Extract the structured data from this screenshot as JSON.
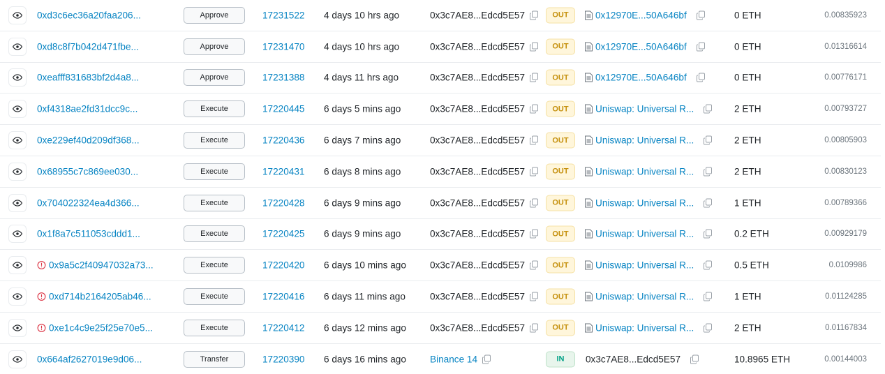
{
  "icons": {
    "view": "eye-icon",
    "error": "alert-circle-icon",
    "copy": "copy-icon",
    "contract": "document-icon"
  },
  "colors": {
    "link": "#0784c3",
    "out_bg": "#fff6db",
    "out_text": "#c5900c",
    "in_bg": "#e8f5ec",
    "in_text": "#00a186",
    "error": "#dc3545"
  },
  "rows": [
    {
      "hash": "0xd3c6ec36a20faa206...",
      "error": false,
      "method": "Approve",
      "block": "17231522",
      "age": "4 days 10 hrs ago",
      "from": "0x3c7AE8...Edcd5E57",
      "from_link": false,
      "direction": "OUT",
      "to": "0x12970E...50A646bf",
      "to_contract": true,
      "value": "0 ETH",
      "fee": "0.00835923"
    },
    {
      "hash": "0xd8c8f7b042d471fbe...",
      "error": false,
      "method": "Approve",
      "block": "17231470",
      "age": "4 days 10 hrs ago",
      "from": "0x3c7AE8...Edcd5E57",
      "from_link": false,
      "direction": "OUT",
      "to": "0x12970E...50A646bf",
      "to_contract": true,
      "value": "0 ETH",
      "fee": "0.01316614"
    },
    {
      "hash": "0xeafff831683bf2d4a8...",
      "error": false,
      "method": "Approve",
      "block": "17231388",
      "age": "4 days 11 hrs ago",
      "from": "0x3c7AE8...Edcd5E57",
      "from_link": false,
      "direction": "OUT",
      "to": "0x12970E...50A646bf",
      "to_contract": true,
      "value": "0 ETH",
      "fee": "0.00776171"
    },
    {
      "hash": "0xf4318ae2fd31dcc9c...",
      "error": false,
      "method": "Execute",
      "block": "17220445",
      "age": "6 days 5 mins ago",
      "from": "0x3c7AE8...Edcd5E57",
      "from_link": false,
      "direction": "OUT",
      "to": "Uniswap: Universal R...",
      "to_contract": true,
      "value": "2 ETH",
      "fee": "0.00793727"
    },
    {
      "hash": "0xe229ef40d209df368...",
      "error": false,
      "method": "Execute",
      "block": "17220436",
      "age": "6 days 7 mins ago",
      "from": "0x3c7AE8...Edcd5E57",
      "from_link": false,
      "direction": "OUT",
      "to": "Uniswap: Universal R...",
      "to_contract": true,
      "value": "2 ETH",
      "fee": "0.00805903"
    },
    {
      "hash": "0x68955c7c869ee030...",
      "error": false,
      "method": "Execute",
      "block": "17220431",
      "age": "6 days 8 mins ago",
      "from": "0x3c7AE8...Edcd5E57",
      "from_link": false,
      "direction": "OUT",
      "to": "Uniswap: Universal R...",
      "to_contract": true,
      "value": "2 ETH",
      "fee": "0.00830123"
    },
    {
      "hash": "0x704022324ea4d366...",
      "error": false,
      "method": "Execute",
      "block": "17220428",
      "age": "6 days 9 mins ago",
      "from": "0x3c7AE8...Edcd5E57",
      "from_link": false,
      "direction": "OUT",
      "to": "Uniswap: Universal R...",
      "to_contract": true,
      "value": "1 ETH",
      "fee": "0.00789366"
    },
    {
      "hash": "0x1f8a7c511053cddd1...",
      "error": false,
      "method": "Execute",
      "block": "17220425",
      "age": "6 days 9 mins ago",
      "from": "0x3c7AE8...Edcd5E57",
      "from_link": false,
      "direction": "OUT",
      "to": "Uniswap: Universal R...",
      "to_contract": true,
      "value": "0.2 ETH",
      "fee": "0.00929179"
    },
    {
      "hash": "0x9a5c2f40947032a73...",
      "error": true,
      "method": "Execute",
      "block": "17220420",
      "age": "6 days 10 mins ago",
      "from": "0x3c7AE8...Edcd5E57",
      "from_link": false,
      "direction": "OUT",
      "to": "Uniswap: Universal R...",
      "to_contract": true,
      "value": "0.5 ETH",
      "fee": "0.0109986"
    },
    {
      "hash": "0xd714b2164205ab46...",
      "error": true,
      "method": "Execute",
      "block": "17220416",
      "age": "6 days 11 mins ago",
      "from": "0x3c7AE8...Edcd5E57",
      "from_link": false,
      "direction": "OUT",
      "to": "Uniswap: Universal R...",
      "to_contract": true,
      "value": "1 ETH",
      "fee": "0.01124285"
    },
    {
      "hash": "0xe1c4c9e25f25e70e5...",
      "error": true,
      "method": "Execute",
      "block": "17220412",
      "age": "6 days 12 mins ago",
      "from": "0x3c7AE8...Edcd5E57",
      "from_link": false,
      "direction": "OUT",
      "to": "Uniswap: Universal R...",
      "to_contract": true,
      "value": "2 ETH",
      "fee": "0.01167834"
    },
    {
      "hash": "0x664af2627019e9d06...",
      "error": false,
      "method": "Transfer",
      "block": "17220390",
      "age": "6 days 16 mins ago",
      "from": "Binance 14",
      "from_link": true,
      "direction": "IN",
      "to": "0x3c7AE8...Edcd5E57",
      "to_contract": false,
      "value": "10.8965 ETH",
      "fee": "0.00144003"
    }
  ]
}
